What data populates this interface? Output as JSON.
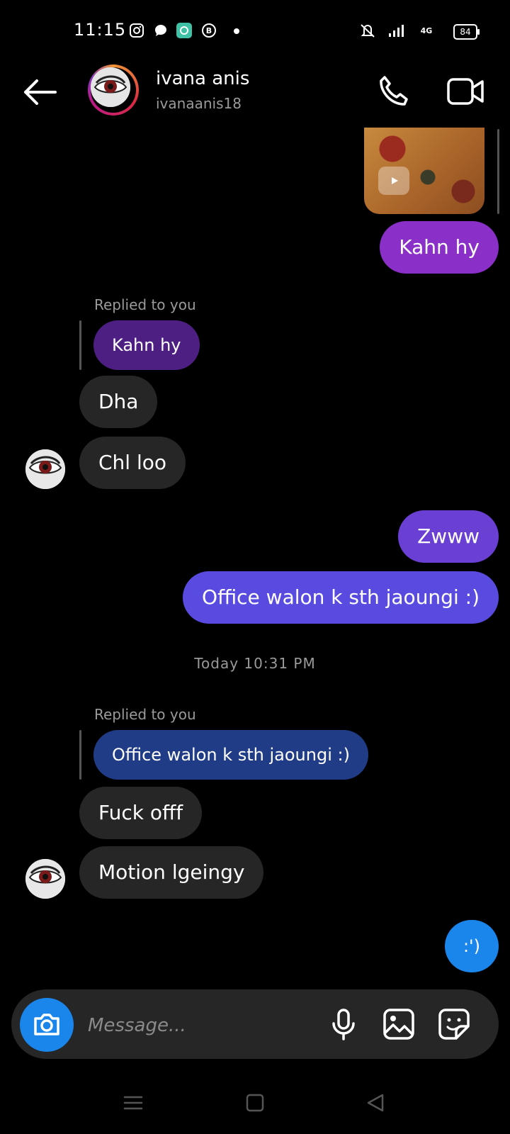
{
  "status_bar": {
    "time": "11:15",
    "battery": "84",
    "network": "4G"
  },
  "header": {
    "name": "ivana anis",
    "username": "ivanaanis18"
  },
  "messages": {
    "out1": "Kahn hy",
    "reply1": {
      "label": "Replied to you",
      "quote": "Kahn hy"
    },
    "in1": "Dha",
    "in2": "Chl loo",
    "out2": "Zwww",
    "out3": "Office walon k sth jaoungi :)",
    "timestamp": "Today 10:31 PM",
    "reply2": {
      "label": "Replied to you",
      "quote": "Office walon k sth jaoungi :)"
    },
    "in3": "Fuck offf",
    "in4": "Motion lgeingy",
    "out4": ":')"
  },
  "composer": {
    "placeholder": "Message..."
  },
  "colors": {
    "accent": "#1a86ec",
    "bubble_in": "#262626",
    "bubble_purple": "#8b2fc9",
    "bubble_violet": "#6a3fd3",
    "bubble_indigo": "#5a4be0"
  }
}
